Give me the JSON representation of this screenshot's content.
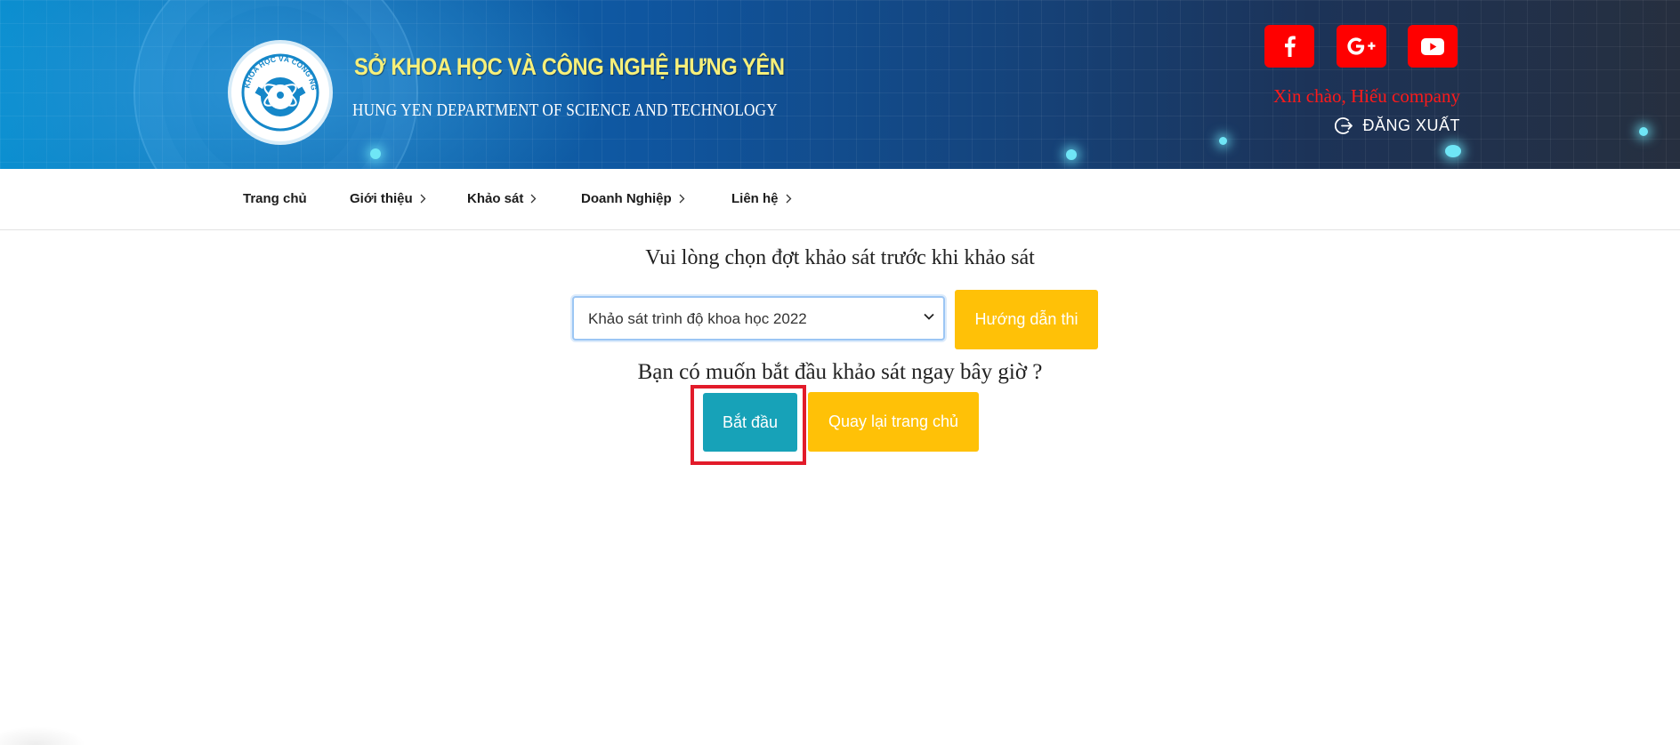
{
  "header": {
    "title_vi": "SỞ KHOA HỌC VÀ CÔNG NGHỆ HƯNG YÊN",
    "title_en": "HUNG YEN DEPARTMENT OF SCIENCE AND TECHNOLOGY",
    "logo_arc_text": "KHOA HỌC VÀ CÔNG NGHỆ",
    "social": [
      {
        "name": "facebook",
        "icon": "facebook-icon"
      },
      {
        "name": "google-plus",
        "icon": "google-plus-icon"
      },
      {
        "name": "youtube",
        "icon": "youtube-icon"
      }
    ],
    "greeting": "Xin chào, Hiếu company",
    "logout_label": "ĐĂNG XUẤT",
    "logout_icon": "logout-icon"
  },
  "nav": {
    "items": [
      {
        "label": "Trang chủ",
        "has_submenu": false
      },
      {
        "label": "Giới thiệu",
        "has_submenu": true
      },
      {
        "label": "Khảo sát",
        "has_submenu": true
      },
      {
        "label": "Doanh Nghiệp",
        "has_submenu": true
      },
      {
        "label": "Liên hệ",
        "has_submenu": true
      }
    ]
  },
  "main": {
    "select_prompt": "Vui lòng chọn đợt khảo sát trước khi khảo sát",
    "survey_select": {
      "selected": "Khảo sát trình độ khoa học 2022"
    },
    "guide_button": "Hướng dẫn thi",
    "start_prompt": "Bạn có muốn bắt đầu khảo sát ngay bây giờ ?",
    "start_button": "Bắt đầu",
    "home_button": "Quay lại trang chủ"
  },
  "colors": {
    "accent_yellow": "#ffc107",
    "accent_teal": "#17a2b8",
    "social_red": "#ff0000",
    "greeting_red": "#ff1a1a",
    "highlight_red": "#e21b2a"
  }
}
